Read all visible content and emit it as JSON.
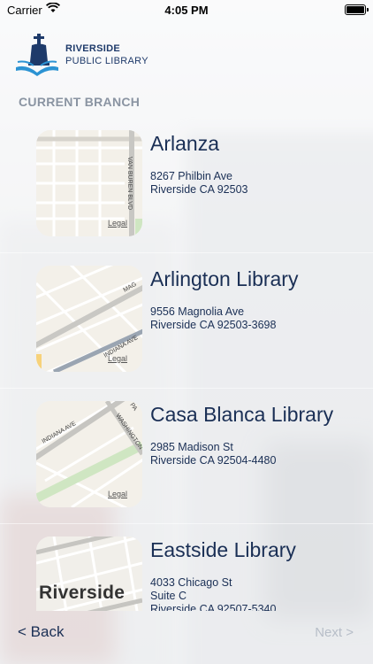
{
  "status_bar": {
    "carrier": "Carrier",
    "time": "4:05 PM"
  },
  "logo": {
    "line1": "RIVERSIDE",
    "line2": "PUBLIC LIBRARY"
  },
  "section_title": "CURRENT BRANCH",
  "branches": [
    {
      "name": "Arlanza",
      "address_line1": "8267 Philbin Ave",
      "address_line2": "Riverside CA 92503",
      "map_legal": "Legal"
    },
    {
      "name": "Arlington Library",
      "address_line1": "9556 Magnolia Ave",
      "address_line2": "Riverside CA 92503-3698",
      "map_legal": "Legal"
    },
    {
      "name": "Casa Blanca Library",
      "address_line1": "2985 Madison St",
      "address_line2": "Riverside CA 92504-4480",
      "map_legal": "Legal"
    },
    {
      "name": "Eastside Library",
      "address_line1": "4033 Chicago St",
      "address_line2": "Suite C",
      "address_line3": "Riverside CA 92507-5340",
      "map_city_label": "Riverside"
    }
  ],
  "map_street_labels": [
    "VAN BUREN BLVD",
    "MAG",
    "INDIANA AVE",
    "INDIANA AVE",
    "WASHINGTON",
    "PA"
  ],
  "navigation": {
    "back_label": "< Back",
    "next_label": "Next >"
  },
  "colors": {
    "text_primary": "#1a2f55",
    "section_title": "#8a94a2",
    "next_disabled": "#b7bec8"
  }
}
